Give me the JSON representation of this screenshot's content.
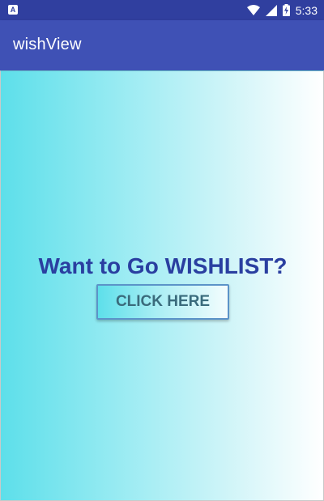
{
  "status_bar": {
    "notification_icon": "android-notification-icon",
    "wifi_icon": "wifi-icon",
    "signal_icon": "cell-signal-icon",
    "battery_icon": "battery-charging-icon",
    "time": "5:33"
  },
  "app_bar": {
    "title": "wishView",
    "color": "#3F51B5"
  },
  "main": {
    "headline": "Want to Go WISHLIST?",
    "button_label": "CLICK HERE",
    "gradient_start": "#5DDFEA",
    "gradient_end": "#FFFFFF",
    "headline_color": "#2A3FA0"
  }
}
